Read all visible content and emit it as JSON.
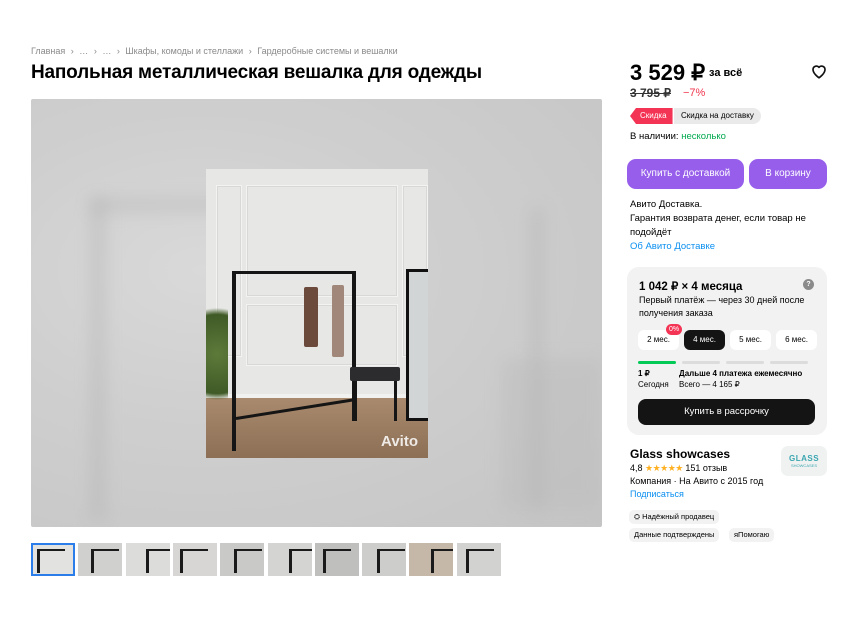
{
  "breadcrumbs": [
    "Главная",
    "›",
    "…",
    "›",
    "…",
    "›",
    "Шкафы, комоды и стеллажи",
    "›",
    "Гардеробные системы и вешалки"
  ],
  "title": "Напольная металлическая вешалка для одежды",
  "gallery": {
    "watermark": "Avito",
    "thumb_count": 10,
    "active_thumb": 1
  },
  "price": {
    "value": "3 529 ₽",
    "suffix": "за всё",
    "old": "3 795 ₽",
    "discount": "−7%"
  },
  "badges": {
    "sale": "Скидка",
    "delivery": "Скидка на доставку"
  },
  "stock": {
    "label": "В наличии:",
    "value": "несколько"
  },
  "buttons": {
    "delivery": "Купить с доставкой",
    "cart": "В корзину"
  },
  "delivery_info": {
    "line1": "Авито Доставка.",
    "line2": "Гарантия возврата денег, если товар не подойдёт",
    "link": "Об Авито Доставке"
  },
  "installment": {
    "headline": "1 042 ₽ × 4 месяца",
    "help": "?",
    "subtitle": "Первый платёж — через 30 дней после получения заказа",
    "zero_badge": "0%",
    "options": [
      "2 мес.",
      "4 мес.",
      "5 мес.",
      "6 мес."
    ],
    "selected": 1,
    "first_amount": "1 ₽",
    "first_when": "Сегодня",
    "rest_title": "Дальше 4 платежа ежемесячно",
    "rest_total": "Всего — 4 165 ₽",
    "button": "Купить в рассрочку"
  },
  "seller": {
    "name": "Glass showcases",
    "rating": "4,8",
    "stars": "★★★★★",
    "reviews": "151 отзыв",
    "company": "Компания · На Авито с 2015 год",
    "subscribe": "Подписаться",
    "logo_text": "GLASS",
    "logo_sub": "SHOWCASES"
  },
  "chips": [
    "Надёжный продавец",
    "Данные подтверждены",
    "яПомогаю"
  ],
  "colors": {
    "accent": "#965eeb",
    "link": "#0a8ff0",
    "sale": "#f43454",
    "stock": "#02a94f"
  }
}
